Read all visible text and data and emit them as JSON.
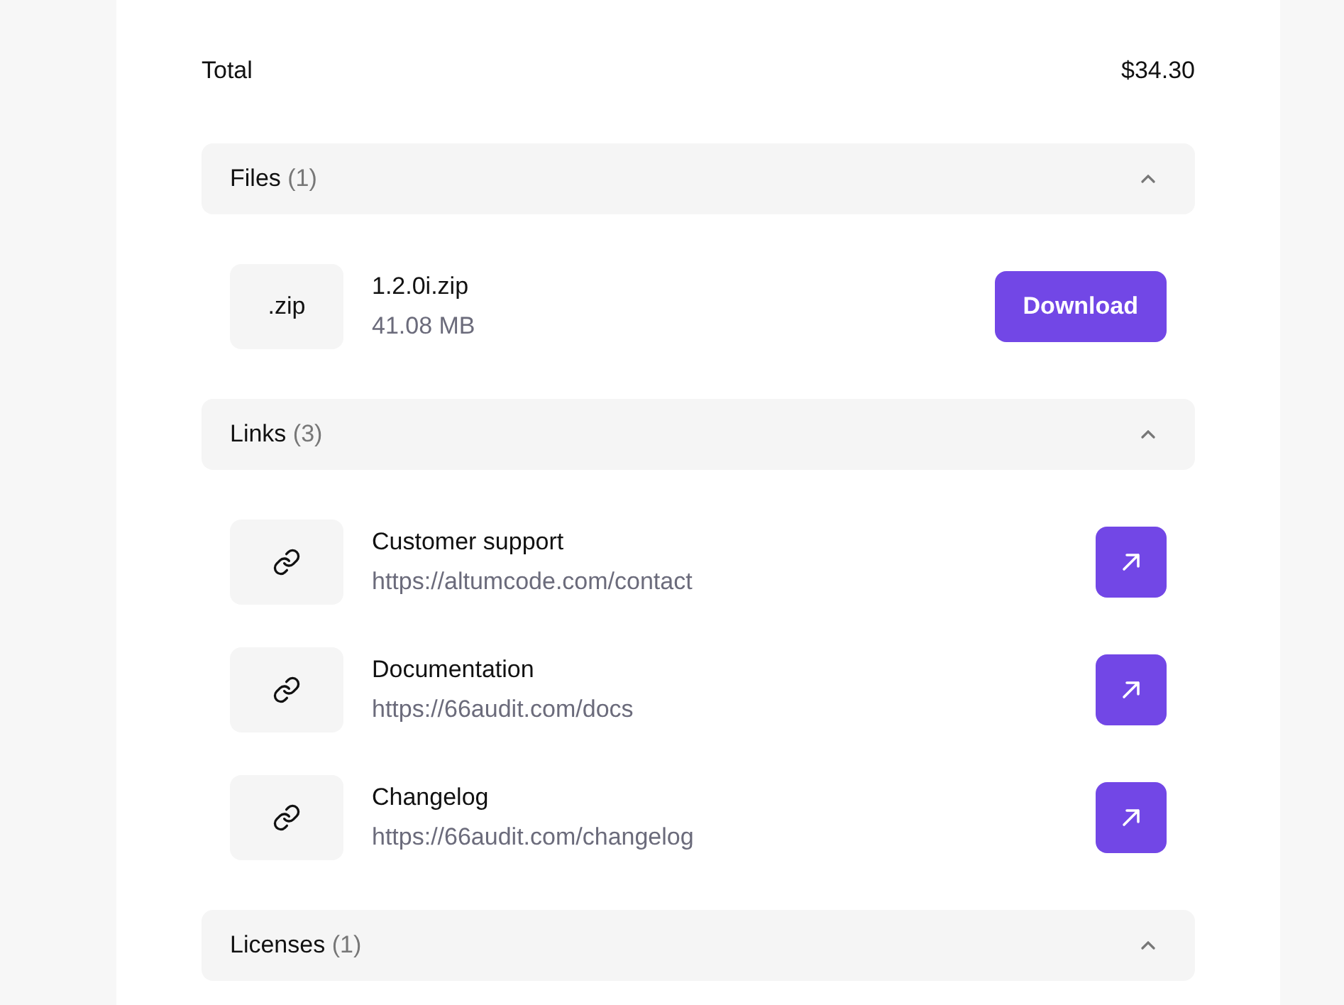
{
  "total": {
    "label": "Total",
    "value": "$34.30"
  },
  "files": {
    "title": "Files",
    "count": "(1)",
    "expanded": true,
    "items": [
      {
        "extension": ".zip",
        "name": "1.2.0i.zip",
        "size": "41.08 MB",
        "action": "Download"
      }
    ]
  },
  "links": {
    "title": "Links",
    "count": "(3)",
    "expanded": true,
    "items": [
      {
        "title": "Customer support",
        "url": "https://altumcode.com/contact"
      },
      {
        "title": "Documentation",
        "url": "https://66audit.com/docs"
      },
      {
        "title": "Changelog",
        "url": "https://66audit.com/changelog"
      }
    ]
  },
  "licenses": {
    "title": "Licenses",
    "count": "(1)",
    "expanded": true
  }
}
